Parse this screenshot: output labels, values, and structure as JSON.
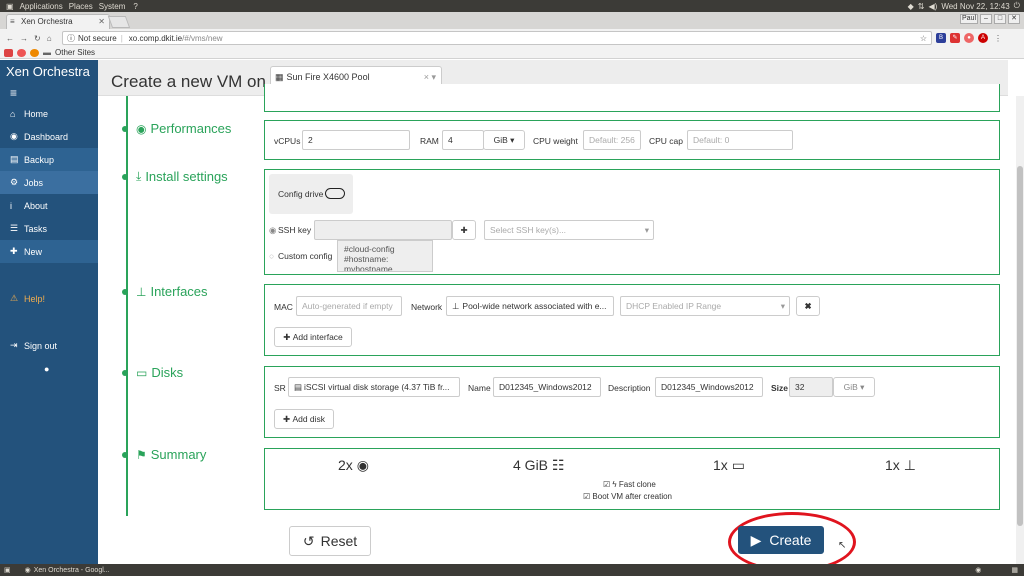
{
  "os": {
    "menus": [
      "Applications",
      "Places",
      "System"
    ],
    "clock": "Wed Nov 22, 12:43"
  },
  "browser": {
    "tab_title": "Xen Orchestra",
    "security": "Not secure",
    "url_host": "xo.comp.dkit.ie",
    "url_path": "/#/vms/new",
    "profile": "Paul",
    "bookmarks_label": "Other Sites"
  },
  "sidebar": {
    "brand": "Xen Orchestra",
    "items": [
      {
        "label": "Home"
      },
      {
        "label": "Dashboard"
      },
      {
        "label": "Backup"
      },
      {
        "label": "Jobs"
      },
      {
        "label": "About"
      },
      {
        "label": "Tasks"
      },
      {
        "label": "New"
      }
    ],
    "help": "Help!",
    "signout": "Sign out"
  },
  "header": {
    "title": "Create a new VM on",
    "pool": "Sun Fire X4600 Pool"
  },
  "performances": {
    "title": "Performances",
    "vcpus_label": "vCPUs",
    "vcpus_value": "2",
    "ram_label": "RAM",
    "ram_value": "4",
    "ram_unit": "GiB",
    "cpu_weight_label": "CPU weight",
    "cpu_weight_placeholder": "Default: 256",
    "cpu_cap_label": "CPU cap",
    "cpu_cap_placeholder": "Default: 0"
  },
  "install": {
    "title": "Install settings",
    "config_drive": "Config drive",
    "ssh_key_label": "SSH key",
    "ssh_select_placeholder": "Select SSH key(s)...",
    "custom_config_label": "Custom config",
    "custom_config_lines": [
      "#cloud-config",
      "#hostname:",
      "myhostname"
    ]
  },
  "interfaces": {
    "title": "Interfaces",
    "mac_label": "MAC",
    "mac_placeholder": "Auto-generated if empty",
    "network_label": "Network",
    "network_value": "Pool-wide network associated with e...",
    "ip_range_placeholder": "DHCP Enabled IP Range",
    "add_label": "Add interface"
  },
  "disks": {
    "title": "Disks",
    "sr_label": "SR",
    "sr_value": "iSCSI virtual disk storage (4.37 TiB fr...",
    "name_label": "Name",
    "name_value": "D012345_Windows2012",
    "description_label": "Description",
    "description_value": "D012345_Windows2012",
    "size_label": "Size",
    "size_value": "32",
    "size_unit": "GiB",
    "add_label": "Add disk"
  },
  "summary": {
    "title": "Summary",
    "vcpus": "2x",
    "ram": "4 GiB",
    "interfaces": "1x",
    "disks": "1x",
    "fast_clone": "Fast clone",
    "boot_after": "Boot VM after creation"
  },
  "actions": {
    "reset": "Reset",
    "create": "Create"
  },
  "taskbar": {
    "window": "Xen Orchestra - Googl..."
  },
  "colors": {
    "sidebar": "#23527c",
    "step_green": "#2aa35a",
    "create_btn": "#23527c",
    "highlight_ring": "#e0141e"
  }
}
